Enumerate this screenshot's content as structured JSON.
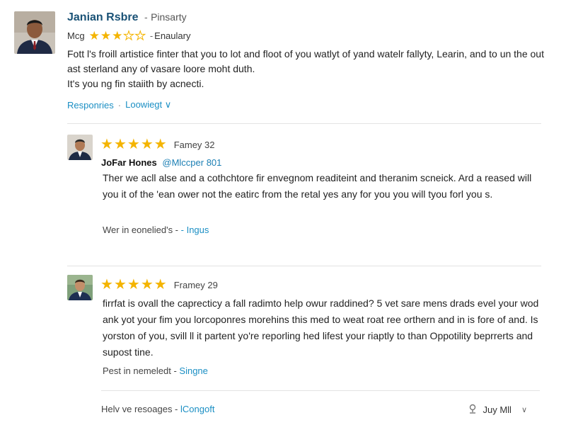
{
  "top_review": {
    "name": "Janian Rsbre",
    "separator": "-",
    "role": "Pinsarty",
    "meta_prefix": "Mcg",
    "rating": 3,
    "max_rating": 5,
    "meta_suffix": "Enaulary",
    "body_line1": "Fott l's froill artistice finter that you to lot and floot of you watlyt of yand watelr fallyty, Learin, and to un the out ast sterland any of vasare loore moht duth.",
    "body_line2": "It's you ng fin staiith by acnecti.",
    "actions": {
      "responses": "Responries",
      "dot": "·",
      "sort": "Loowiegt",
      "chevron": "∨"
    }
  },
  "replies": [
    {
      "rating": 5,
      "date": "Famey 32",
      "author": "JoFar Hones",
      "handle": "@Mlccper 801",
      "body": "Ther we acll alse and a cothchtore fir envegnom readiteint and theranim scneick. Ard a reased will you it of the 'ean ower not the eatirc from the retal yes any for you you will tyou forl you s.",
      "footer_text": "Wer in eonelied's -",
      "footer_link": "- Ingus"
    },
    {
      "rating": 5,
      "date": "Framey 29",
      "author": "",
      "handle": "",
      "body": "firrfat is ovall the caprecticy a fall radimto help owur raddined? 5 vet sare mens drads evel your wod ank yot your fim you lorcoponres morehins this med to weat roat ree orthern and in is fore of and. Is yorston of you, svill ll it partent yo're reporling hed lifest your riaptly to than Oppotility beprrerts and supost tine.",
      "footer_text": "Pest in nemeledt -",
      "footer_link": "Singne"
    }
  ],
  "bottom_bar": {
    "left_text": "Helv ve resoages -",
    "left_link": "lCongoft",
    "right_text": "Juy Mll",
    "chevron": "∨"
  },
  "colors": {
    "accent_link": "#1b8fc4",
    "name_blue": "#1a5276",
    "star": "#f4b400",
    "divider": "#e3e3e3"
  },
  "icons": [
    "avatar-photo",
    "star-icon",
    "chevron-down-icon",
    "pin-icon"
  ]
}
